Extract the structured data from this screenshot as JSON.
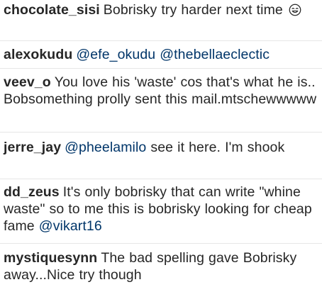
{
  "comments": [
    {
      "username": "chocolate_sisi",
      "text": "Bobrisky try harder next time",
      "emoji": "smiling-face-emoji"
    },
    {
      "username": "alexokudu",
      "mention1": "@efe_okudu",
      "mention2": "@thebellaeclectic"
    },
    {
      "username": "veev_o",
      "text": "You love his 'waste' cos that's what he is.. Bobsomething prolly sent this mail.mtschewwwww"
    },
    {
      "username": "jerre_jay",
      "mention1": "@pheelamilo",
      "text": "see it here. I'm shook"
    },
    {
      "username": "dd_zeus",
      "text": "It's only bobrisky that can write \"whine waste\" so to me this is bobrisky looking for cheap fame",
      "mention1": "@vikart16"
    },
    {
      "username": "mystiquesynn",
      "text": "The bad spelling gave Bobrisky away...Nice try though"
    }
  ],
  "colors": {
    "text": "#262626",
    "mention": "#003569",
    "divider": "#e6e6e6"
  }
}
